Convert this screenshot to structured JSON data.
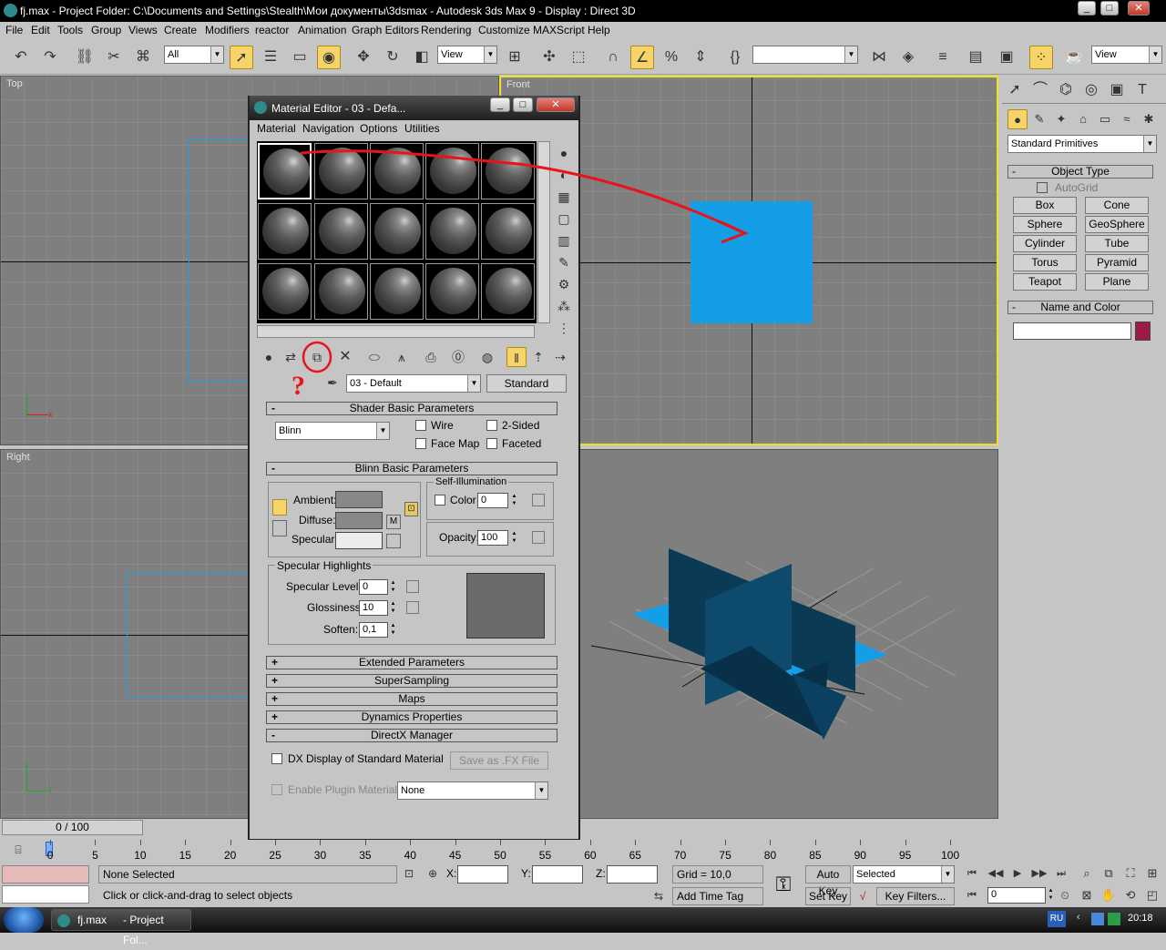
{
  "window": {
    "title": "fj.max   - Project Folder: C:\\Documents and Settings\\Stealth\\Мои документы\\3dsmax     - Autodesk 3ds Max 9     - Display : Direct 3D",
    "min": "_",
    "max": "□",
    "close": "✕"
  },
  "menu": [
    "File",
    "Edit",
    "Tools",
    "Group",
    "Views",
    "Create",
    "Modifiers",
    "reactor",
    "Animation",
    "Graph Editors",
    "Rendering",
    "Customize",
    "MAXScript",
    "Help"
  ],
  "toolbar": {
    "selection_filter": "All",
    "ref_coord": "View",
    "named_sel": "",
    "view2": "View"
  },
  "viewports": {
    "top": "Top",
    "front": "Front",
    "right": "Right",
    "axis_x": "x",
    "axis_y": "y",
    "axis_z": "z"
  },
  "material_editor": {
    "title": "Material Editor - 03 - Defa...",
    "menu": [
      "Material",
      "Navigation",
      "Options",
      "Utilities"
    ],
    "annotation": "?",
    "material_name": "03 - Default",
    "material_type": "Standard",
    "shader_section": "Shader Basic Parameters",
    "shader": "Blinn",
    "wire": "Wire",
    "two_sided": "2-Sided",
    "face_map": "Face Map",
    "faceted": "Faceted",
    "blinn_section": "Blinn Basic Parameters",
    "self_illum": "Self-Illumination",
    "color_lbl": "Color",
    "color_val": "0",
    "ambient": "Ambient:",
    "diffuse": "Diffuse:",
    "specular": "Specular:",
    "m_btn": "M",
    "opacity_lbl": "Opacity:",
    "opacity_val": "100",
    "spec_highlights": "Specular Highlights",
    "spec_level_lbl": "Specular Level:",
    "spec_level": "0",
    "gloss_lbl": "Glossiness:",
    "gloss": "10",
    "soften_lbl": "Soften:",
    "soften": "0,1",
    "rollouts": [
      "Extended Parameters",
      "SuperSampling",
      "Maps",
      "Dynamics Properties"
    ],
    "directx_section": "DirectX Manager",
    "dx_display": "DX Display of Standard Material",
    "save_fx": "Save as .FX File",
    "enable_plugin": "Enable Plugin Material",
    "plugin_val": "None",
    "plus": "+",
    "minus": "-"
  },
  "command_panel": {
    "category": "Standard Primitives",
    "object_type": "Object Type",
    "autogrid": "AutoGrid",
    "buttons": [
      "Box",
      "Cone",
      "Sphere",
      "GeoSphere",
      "Cylinder",
      "Tube",
      "Torus",
      "Pyramid",
      "Teapot",
      "Plane"
    ],
    "name_color": "Name and Color",
    "name_value": "",
    "color_hex": "#9b1b45"
  },
  "timeline": {
    "frame_counter": "0 / 100",
    "ticks": [
      "0",
      "5",
      "10",
      "15",
      "20",
      "25",
      "30",
      "35",
      "40",
      "45",
      "50",
      "55",
      "60",
      "65",
      "70",
      "75",
      "80",
      "85",
      "90",
      "95",
      "100"
    ]
  },
  "status": {
    "selection": "None Selected",
    "prompt": "Click or click-and-drag to select objects",
    "x_lbl": "X:",
    "y_lbl": "Y:",
    "z_lbl": "Z:",
    "grid": "Grid = 10,0",
    "add_time_tag": "Add Time Tag",
    "auto_key": "Auto Key",
    "set_key": "Set Key",
    "key_mode": "Selected",
    "key_filters": "Key Filters...",
    "frame": "0"
  },
  "taskbar": {
    "items": [
      "fj.max",
      "- Project Fol..."
    ],
    "lang": "RU",
    "time": "20:18"
  },
  "colors": {
    "accent_blue": "#149ee6",
    "annotation_red": "#e8141c",
    "active_viewport": "#f0e020"
  }
}
